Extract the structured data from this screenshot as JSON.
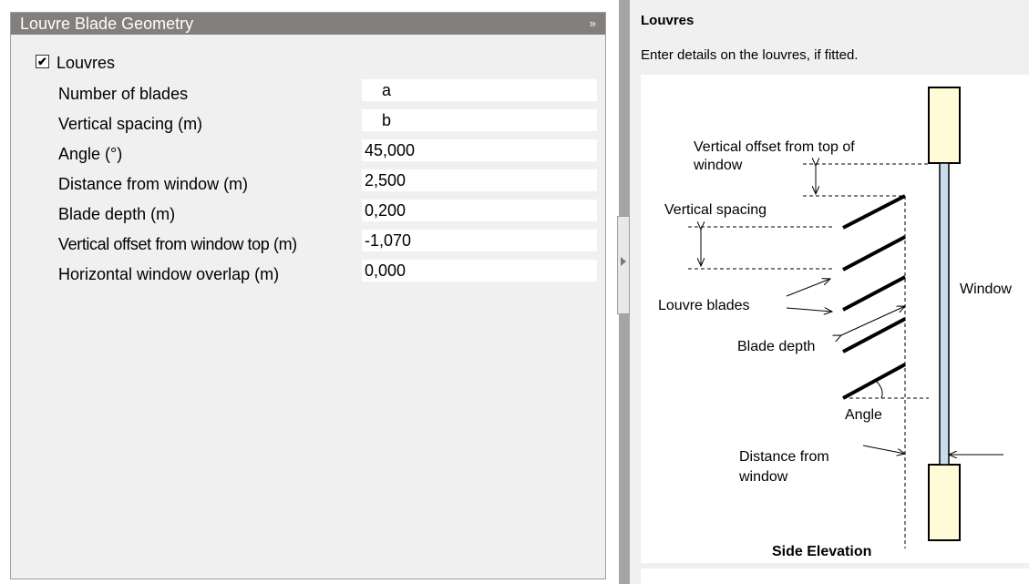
{
  "section": {
    "title": "Louvre Blade Geometry",
    "collapse_glyph": "»"
  },
  "louvres_checkbox": {
    "label": "Louvres",
    "checked": true,
    "check_glyph": "✔"
  },
  "properties": [
    {
      "label": "Number of blades",
      "value": "a"
    },
    {
      "label": "Vertical spacing (m)",
      "value": "b"
    },
    {
      "label": "Angle (°)",
      "value": "45,000"
    },
    {
      "label": "Distance from window (m)",
      "value": "2,500"
    },
    {
      "label": "Blade depth (m)",
      "value": "0,200"
    },
    {
      "label": "Vertical offset from window top (m)",
      "value": "-1,070"
    },
    {
      "label": "Horizontal window overlap (m)",
      "value": "0,000"
    }
  ],
  "help": {
    "title": "Louvres",
    "subtitle": "Enter details on the louvres, if fitted."
  },
  "diagram": {
    "label_offset_line1": "Vertical offset from top of",
    "label_offset_line2": "window",
    "label_vertical_spacing": "Vertical spacing",
    "label_louvre_blades": "Louvre blades",
    "label_blade_depth": "Blade depth",
    "label_window": "Window",
    "label_angle": "Angle",
    "label_distance_line1": "Distance from",
    "label_distance_line2": "window",
    "label_side_elevation": "Side Elevation",
    "window_frame_color": "#fffbd6",
    "glass_color": "#c8dcea"
  }
}
